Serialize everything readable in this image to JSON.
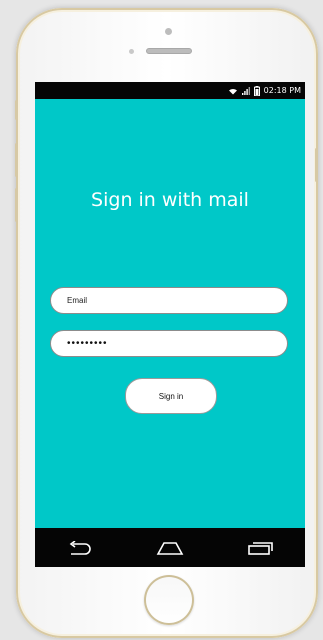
{
  "status_bar": {
    "time": "02:18 PM",
    "icons": [
      "wifi-icon",
      "signal-icon",
      "battery-icon"
    ]
  },
  "screen": {
    "title": "Sign in with mail",
    "email_placeholder": "Email",
    "password_value": "•••••••••",
    "signin_label": "Sign in"
  },
  "nav_bar": {
    "icons": [
      "back-icon",
      "home-nav-icon",
      "recent-apps-icon"
    ]
  },
  "colors": {
    "screen_bg": "#00c8c8",
    "bar_bg": "#050505",
    "field_bg": "#ffffff",
    "text_on_accent": "#ffffff"
  }
}
